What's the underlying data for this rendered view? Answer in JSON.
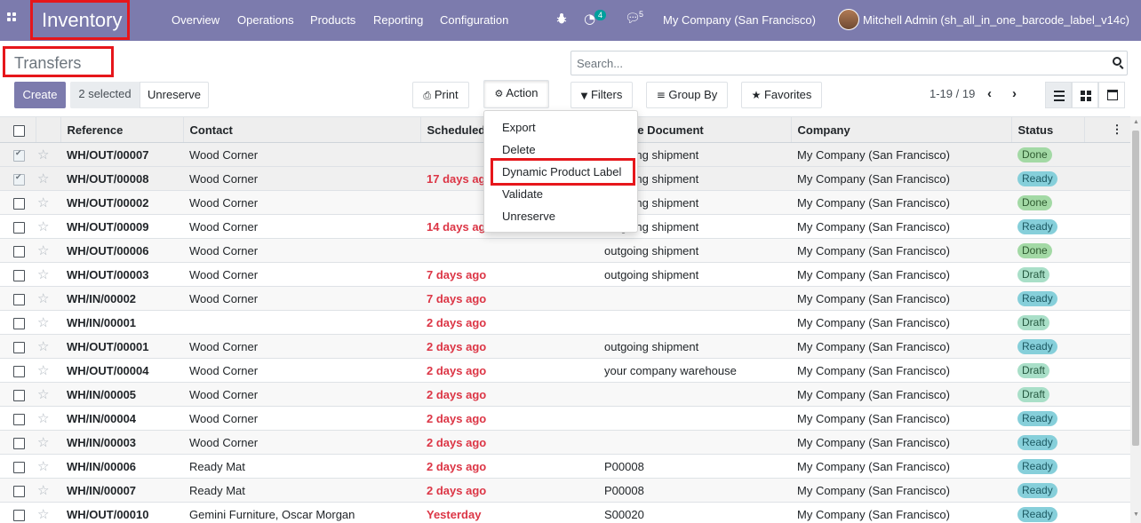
{
  "navbar": {
    "app_title": "Inventory",
    "menu": [
      "Overview",
      "Operations",
      "Products",
      "Reporting",
      "Configuration"
    ],
    "activity_count": "4",
    "message_count": "5",
    "company": "My Company (San Francisco)",
    "user": "Mitchell Admin (sh_all_in_one_barcode_label_v14c)"
  },
  "control": {
    "breadcrumb": "Transfers",
    "create_label": "Create",
    "selected_label": "2 selected",
    "unreserve_label": "Unreserve",
    "print_label": "Print",
    "action_label": "Action",
    "search_placeholder": "Search...",
    "filters_label": "Filters",
    "groupby_label": "Group By",
    "favorites_label": "Favorites",
    "pager": "1-19 / 19"
  },
  "action_menu": [
    "Export",
    "Delete",
    "Dynamic Product Label",
    "Validate",
    "Unreserve"
  ],
  "table": {
    "headers": [
      "Reference",
      "Contact",
      "Scheduled Date",
      "Source Document",
      "Company",
      "Status"
    ],
    "rows": [
      {
        "ref": "WH/OUT/00007",
        "contact": "Wood Corner",
        "date": "",
        "source": "outgoing shipment",
        "company": "My Company (San Francisco)",
        "status": "Done",
        "checked": true
      },
      {
        "ref": "WH/OUT/00008",
        "contact": "Wood Corner",
        "date": "17 days ago",
        "source": "outgoing shipment",
        "company": "My Company (San Francisco)",
        "status": "Ready",
        "checked": true
      },
      {
        "ref": "WH/OUT/00002",
        "contact": "Wood Corner",
        "date": "",
        "source": "outgoing shipment",
        "company": "My Company (San Francisco)",
        "status": "Done",
        "checked": false
      },
      {
        "ref": "WH/OUT/00009",
        "contact": "Wood Corner",
        "date": "14 days ago",
        "source": "outgoing shipment",
        "company": "My Company (San Francisco)",
        "status": "Ready",
        "checked": false
      },
      {
        "ref": "WH/OUT/00006",
        "contact": "Wood Corner",
        "date": "",
        "source": "outgoing shipment",
        "company": "My Company (San Francisco)",
        "status": "Done",
        "checked": false
      },
      {
        "ref": "WH/OUT/00003",
        "contact": "Wood Corner",
        "date": "7 days ago",
        "source": "outgoing shipment",
        "company": "My Company (San Francisco)",
        "status": "Draft",
        "checked": false
      },
      {
        "ref": "WH/IN/00002",
        "contact": "Wood Corner",
        "date": "7 days ago",
        "source": "",
        "company": "My Company (San Francisco)",
        "status": "Ready",
        "checked": false
      },
      {
        "ref": "WH/IN/00001",
        "contact": "",
        "date": "2 days ago",
        "source": "",
        "company": "My Company (San Francisco)",
        "status": "Draft",
        "checked": false
      },
      {
        "ref": "WH/OUT/00001",
        "contact": "Wood Corner",
        "date": "2 days ago",
        "source": "outgoing shipment",
        "company": "My Company (San Francisco)",
        "status": "Ready",
        "checked": false
      },
      {
        "ref": "WH/OUT/00004",
        "contact": "Wood Corner",
        "date": "2 days ago",
        "source": "your company warehouse",
        "company": "My Company (San Francisco)",
        "status": "Draft",
        "checked": false
      },
      {
        "ref": "WH/IN/00005",
        "contact": "Wood Corner",
        "date": "2 days ago",
        "source": "",
        "company": "My Company (San Francisco)",
        "status": "Draft",
        "checked": false
      },
      {
        "ref": "WH/IN/00004",
        "contact": "Wood Corner",
        "date": "2 days ago",
        "source": "",
        "company": "My Company (San Francisco)",
        "status": "Ready",
        "checked": false
      },
      {
        "ref": "WH/IN/00003",
        "contact": "Wood Corner",
        "date": "2 days ago",
        "source": "",
        "company": "My Company (San Francisco)",
        "status": "Ready",
        "checked": false
      },
      {
        "ref": "WH/IN/00006",
        "contact": "Ready Mat",
        "date": "2 days ago",
        "source": "P00008",
        "company": "My Company (San Francisco)",
        "status": "Ready",
        "checked": false
      },
      {
        "ref": "WH/IN/00007",
        "contact": "Ready Mat",
        "date": "2 days ago",
        "source": "P00008",
        "company": "My Company (San Francisco)",
        "status": "Ready",
        "checked": false
      },
      {
        "ref": "WH/OUT/00010",
        "contact": "Gemini Furniture, Oscar Morgan",
        "date": "Yesterday",
        "source": "S00020",
        "company": "My Company (San Francisco)",
        "status": "Ready",
        "checked": false
      }
    ]
  },
  "colors": {
    "navbar": "#7c7bad",
    "highlight": "#e6161b",
    "late": "#dc3545"
  }
}
